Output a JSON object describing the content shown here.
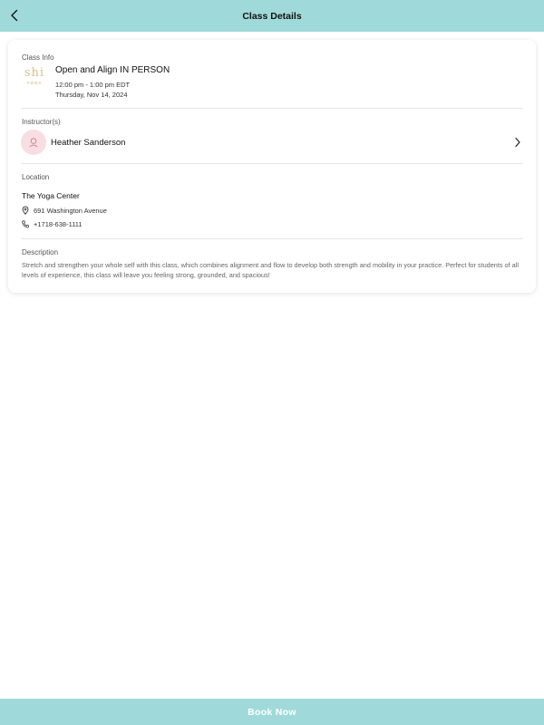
{
  "header": {
    "title": "Class Details",
    "back_icon": "chevron-left-icon"
  },
  "class_info": {
    "label": "Class Info",
    "logo_mark": "shi",
    "logo_sub": "YOGA",
    "title": "Open and Align IN PERSON",
    "time": "12:00 pm - 1:00 pm EDT",
    "date": "Thursday, Nov 14, 2024"
  },
  "instructor": {
    "label": "Instructor(s)",
    "name": "Heather Sanderson",
    "avatar_icon": "user-icon",
    "chevron_icon": "chevron-right-icon"
  },
  "location": {
    "label": "Location",
    "name": "The Yoga Center",
    "address": "691 Washington Avenue",
    "phone": "+1718-638-1111"
  },
  "description": {
    "label": "Description",
    "text": "Stretch and strengthen your whole self with this class, which combines alignment and flow to develop both strength and mobility in your practice. Perfect for students of all levels of experience, this class will leave you feeling strong, grounded, and spacious!"
  },
  "footer": {
    "book_label": "Book Now"
  },
  "colors": {
    "accent": "#a0d9d9",
    "avatar_bg": "#f8dde2",
    "avatar_icon": "#d9838f"
  }
}
